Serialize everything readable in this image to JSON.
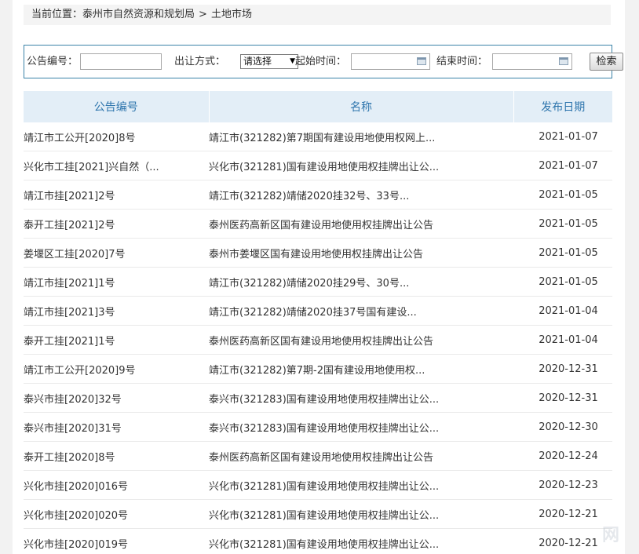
{
  "breadcrumb": {
    "prefix": "当前位置：",
    "items": [
      "泰州市自然资源和规划局",
      "土地市场"
    ],
    "separator": ">"
  },
  "search": {
    "notice_no_label": "公告编号：",
    "notice_no_value": "",
    "transfer_label": "出让方式：",
    "transfer_selected": "请选择",
    "start_label": "起始时间：",
    "start_value": "",
    "end_label": "结束时间：",
    "end_value": "",
    "search_button": "检索"
  },
  "table": {
    "headers": [
      "公告编号",
      "名称",
      "发布日期"
    ],
    "rows": [
      [
        "靖江市工公开[2020]8号",
        "靖江市(321282)第7期国有建设用地使用权网上...",
        "2021-01-07"
      ],
      [
        "兴化市工挂[2021]兴自然（...",
        "兴化市(321281)国有建设用地使用权挂牌出让公...",
        "2021-01-07"
      ],
      [
        "靖江市挂[2021]2号",
        "靖江市(321282)靖储2020挂32号、33号...",
        "2021-01-05"
      ],
      [
        "泰开工挂[2021]2号",
        "泰州医药高新区国有建设用地使用权挂牌出让公告",
        "2021-01-05"
      ],
      [
        "姜堰区工挂[2020]7号",
        "泰州市姜堰区国有建设用地使用权挂牌出让公告",
        "2021-01-05"
      ],
      [
        "靖江市挂[2021]1号",
        "靖江市(321282)靖储2020挂29号、30号...",
        "2021-01-05"
      ],
      [
        "靖江市挂[2021]3号",
        "靖江市(321282)靖储2020挂37号国有建设...",
        "2021-01-04"
      ],
      [
        "泰开工挂[2021]1号",
        "泰州医药高新区国有建设用地使用权挂牌出让公告",
        "2021-01-04"
      ],
      [
        "靖江市工公开[2020]9号",
        "靖江市(321282)第7期-2国有建设用地使用权...",
        "2020-12-31"
      ],
      [
        "泰兴市挂[2020]32号",
        "泰兴市(321283)国有建设用地使用权挂牌出让公...",
        "2020-12-31"
      ],
      [
        "泰兴市挂[2020]31号",
        "泰兴市(321283)国有建设用地使用权挂牌出让公...",
        "2020-12-30"
      ],
      [
        "泰开工挂[2020]8号",
        "泰州医药高新区国有建设用地使用权挂牌出让公告",
        "2020-12-24"
      ],
      [
        "兴化市挂[2020]016号",
        "兴化市(321281)国有建设用地使用权挂牌出让公...",
        "2020-12-23"
      ],
      [
        "兴化市挂[2020]020号",
        "兴化市(321281)国有建设用地使用权挂牌出让公...",
        "2020-12-21"
      ],
      [
        "兴化市挂[2020]019号",
        "兴化市(321281)国有建设用地使用权挂牌出让公...",
        "2020-12-21"
      ]
    ]
  }
}
